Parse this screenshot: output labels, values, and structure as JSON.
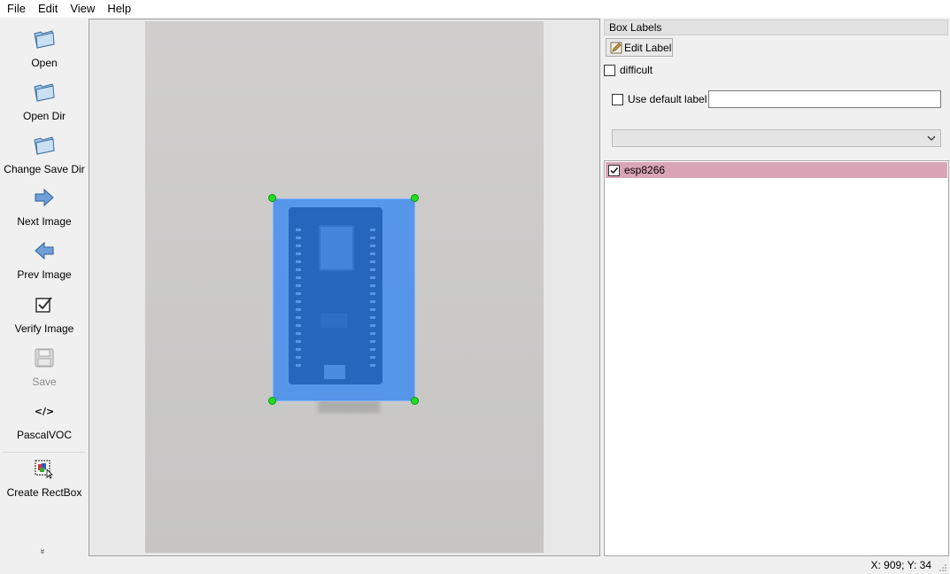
{
  "menu": [
    "File",
    "Edit",
    "View",
    "Help"
  ],
  "toolbar": {
    "open": "Open",
    "open_dir": "Open Dir",
    "change_save_dir": "Change Save Dir",
    "next_image": "Next Image",
    "prev_image": "Prev Image",
    "verify_image": "Verify Image",
    "save": "Save",
    "format_icon_text": "</>",
    "format": "PascalVOC",
    "create_rectbox": "Create RectBox",
    "more": "»"
  },
  "panel": {
    "title": "Box Labels",
    "edit_label": "Edit Label",
    "difficult": "difficult",
    "use_default_label": "Use default label",
    "default_label_value": "",
    "combo_selected": "",
    "labels": [
      {
        "text": "esp8266",
        "checked": true,
        "color": "#d9a5b6"
      }
    ]
  },
  "annotation": {
    "label": "esp8266",
    "fill_color": "#2a82f6",
    "handle_color": "#22dd22"
  },
  "status": {
    "coords": "X: 909; Y: 34"
  },
  "colors": {
    "selected_label_bg": "#d9a5b6",
    "bbox_fill": "#2a82f6"
  }
}
